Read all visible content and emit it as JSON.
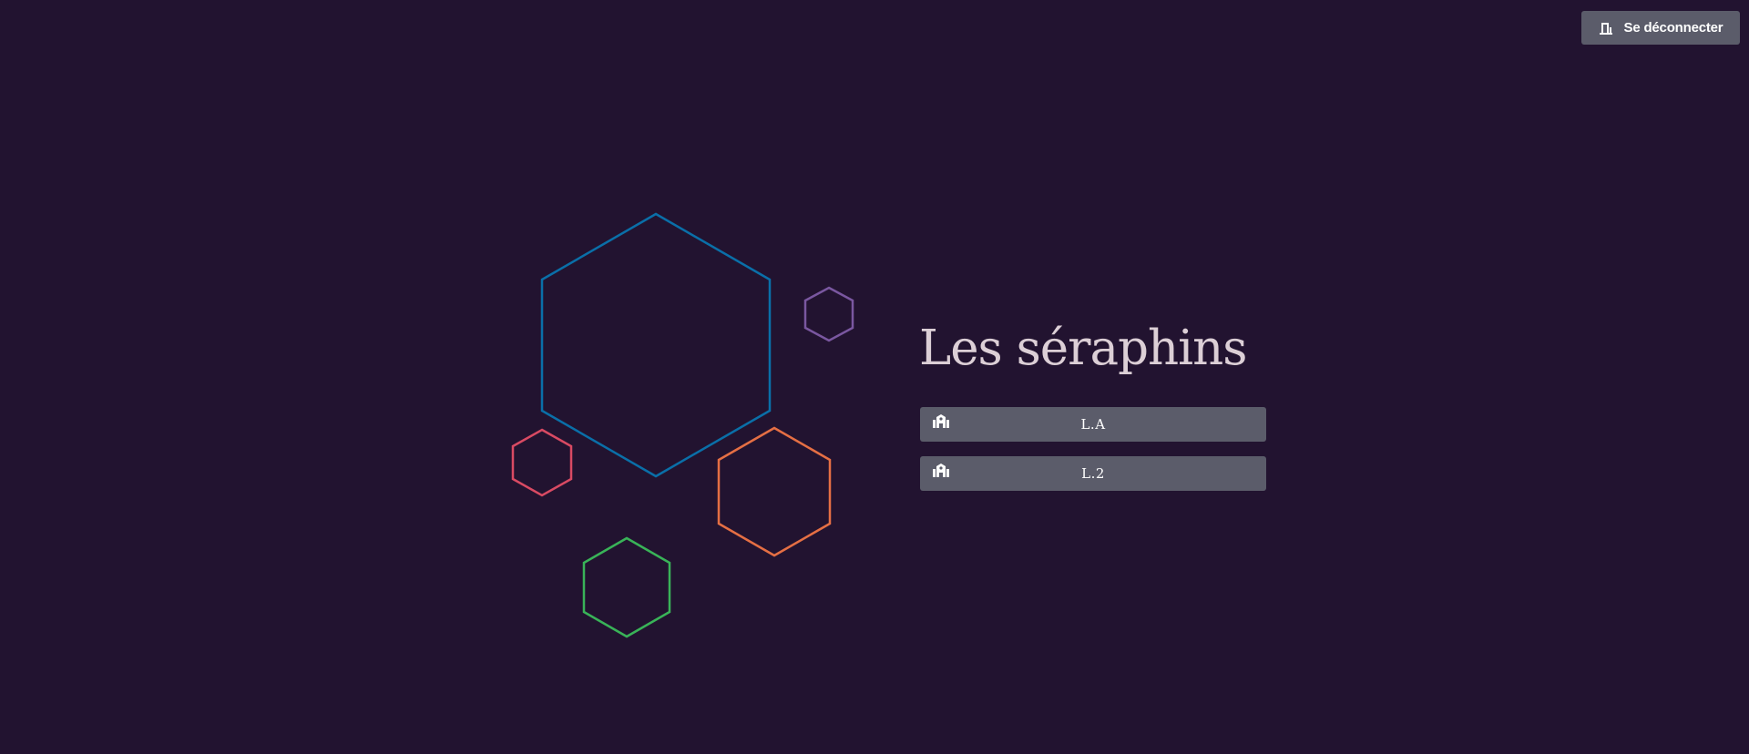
{
  "header": {
    "logout_label": "Se déconnecter",
    "logout_icon": "door-exit-icon"
  },
  "main": {
    "title": "Les séraphins",
    "classes": [
      {
        "label": "L.A",
        "icon": "school-building-icon"
      },
      {
        "label": "L.2",
        "icon": "school-building-icon"
      }
    ]
  },
  "colors": {
    "background": "#221330",
    "button": "#5b5c6a",
    "title_text": "#dccfd6",
    "hex_blue": "#0a6fa8",
    "hex_purple": "#7a57a0",
    "hex_red": "#d94a63",
    "hex_orange": "#e56f44",
    "hex_green": "#39b358"
  }
}
